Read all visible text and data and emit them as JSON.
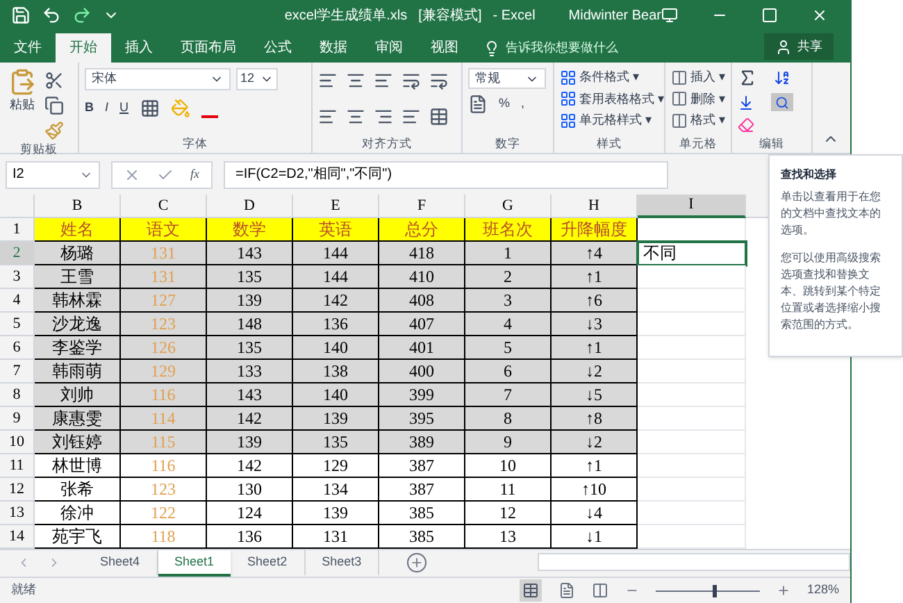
{
  "title_bar": {
    "title": "excel学生成绩单.xls",
    "mode": "[兼容模式]",
    "app": "- Excel",
    "user": "Midwinter Bear"
  },
  "ribbon_tabs": [
    {
      "label": "文件",
      "selected": false
    },
    {
      "label": "开始",
      "selected": true
    },
    {
      "label": "插入",
      "selected": false
    },
    {
      "label": "页面布局",
      "selected": false
    },
    {
      "label": "公式",
      "selected": false
    },
    {
      "label": "数据",
      "selected": false
    },
    {
      "label": "审阅",
      "selected": false
    },
    {
      "label": "视图",
      "selected": false
    }
  ],
  "tell_me": "告诉我你想要做什么",
  "share": "共享",
  "ribbon": {
    "paste": "粘贴",
    "font_name": "宋体",
    "font_size": "12",
    "bold": "B",
    "italic": "I",
    "underline": "U",
    "number_format": "常规",
    "percent": "%",
    "comma": ",",
    "styles": [
      "条件格式 ▾",
      "套用表格格式 ▾",
      "单元格样式 ▾"
    ],
    "cells": [
      "插入 ▾",
      "删除 ▾",
      "格式 ▾"
    ],
    "groups": [
      "剪贴板",
      "字体",
      "对齐方式",
      "数字",
      "样式",
      "单元格",
      "编辑"
    ]
  },
  "formula_bar": {
    "name_box": "I2",
    "fx": "fx",
    "formula": "=IF(C2=D2,\"相同\",\"不同\")"
  },
  "columns": [
    {
      "letter": "B",
      "selected": false,
      "color": "#000000"
    },
    {
      "letter": "C",
      "selected": false,
      "color": "#e0a050"
    },
    {
      "letter": "D",
      "selected": false,
      "color": "#000000"
    },
    {
      "letter": "E",
      "selected": false,
      "color": "#000000"
    },
    {
      "letter": "F",
      "selected": false,
      "color": "#000000"
    },
    {
      "letter": "G",
      "selected": false,
      "color": "#000000"
    },
    {
      "letter": "H",
      "selected": false,
      "color": "#000000"
    },
    {
      "letter": "I",
      "selected": true,
      "color": "#000000"
    }
  ],
  "rows": [
    {
      "number": "1",
      "kind": "header",
      "selected": false,
      "shaded": false,
      "cells": [
        "姓名",
        "语文",
        "数学",
        "英语",
        "总分",
        "班名次",
        "升降幅度",
        ""
      ]
    },
    {
      "number": "2",
      "kind": "data",
      "selected": true,
      "shaded": true,
      "cells": [
        "杨璐",
        "131",
        "143",
        "144",
        "418",
        "1",
        "↑4",
        "不同"
      ]
    },
    {
      "number": "3",
      "kind": "data",
      "selected": false,
      "shaded": true,
      "cells": [
        "王雪",
        "131",
        "135",
        "144",
        "410",
        "2",
        "↑1",
        ""
      ]
    },
    {
      "number": "4",
      "kind": "data",
      "selected": false,
      "shaded": true,
      "cells": [
        "韩林霖",
        "127",
        "139",
        "142",
        "408",
        "3",
        "↑6",
        ""
      ]
    },
    {
      "number": "5",
      "kind": "data",
      "selected": false,
      "shaded": true,
      "cells": [
        "沙龙逸",
        "123",
        "148",
        "136",
        "407",
        "4",
        "↓3",
        ""
      ]
    },
    {
      "number": "6",
      "kind": "data",
      "selected": false,
      "shaded": true,
      "cells": [
        "李鉴学",
        "126",
        "135",
        "140",
        "401",
        "5",
        "↑1",
        ""
      ]
    },
    {
      "number": "7",
      "kind": "data",
      "selected": false,
      "shaded": true,
      "cells": [
        "韩雨萌",
        "129",
        "133",
        "138",
        "400",
        "6",
        "↓2",
        ""
      ]
    },
    {
      "number": "8",
      "kind": "data",
      "selected": false,
      "shaded": true,
      "cells": [
        "刘帅",
        "116",
        "143",
        "140",
        "399",
        "7",
        "↓5",
        ""
      ]
    },
    {
      "number": "9",
      "kind": "data",
      "selected": false,
      "shaded": true,
      "cells": [
        "康惠雯",
        "114",
        "142",
        "139",
        "395",
        "8",
        "↑8",
        ""
      ]
    },
    {
      "number": "10",
      "kind": "data",
      "selected": false,
      "shaded": true,
      "cells": [
        "刘钰婷",
        "115",
        "139",
        "135",
        "389",
        "9",
        "↓2",
        ""
      ]
    },
    {
      "number": "11",
      "kind": "data",
      "selected": false,
      "shaded": false,
      "cells": [
        "林世博",
        "116",
        "142",
        "129",
        "387",
        "10",
        "↑1",
        ""
      ]
    },
    {
      "number": "12",
      "kind": "data",
      "selected": false,
      "shaded": false,
      "cells": [
        "张希",
        "123",
        "130",
        "134",
        "387",
        "11",
        "↑10",
        ""
      ]
    },
    {
      "number": "13",
      "kind": "data",
      "selected": false,
      "shaded": false,
      "cells": [
        "徐冲",
        "122",
        "124",
        "139",
        "385",
        "12",
        "↓4",
        ""
      ]
    },
    {
      "number": "14",
      "kind": "data",
      "selected": false,
      "shaded": false,
      "cells": [
        "苑宇飞",
        "118",
        "136",
        "131",
        "385",
        "13",
        "↓1",
        ""
      ]
    }
  ],
  "sheet_tabs": [
    {
      "label": "Sheet4",
      "selected": false
    },
    {
      "label": "Sheet1",
      "selected": true
    },
    {
      "label": "Sheet2",
      "selected": false
    },
    {
      "label": "Sheet3",
      "selected": false
    }
  ],
  "status": "就绪",
  "zoom": {
    "level": 0.55,
    "reading": "128%"
  },
  "tooltip": {
    "title": "查找和选择",
    "paragraphs": [
      "单击以查看用于在您的文档中查找文本的选项。",
      "您可以使用高级搜索选项查找和替换文本、跳转到某个特定位置或者选择缩小搜索范围的方式。"
    ]
  }
}
